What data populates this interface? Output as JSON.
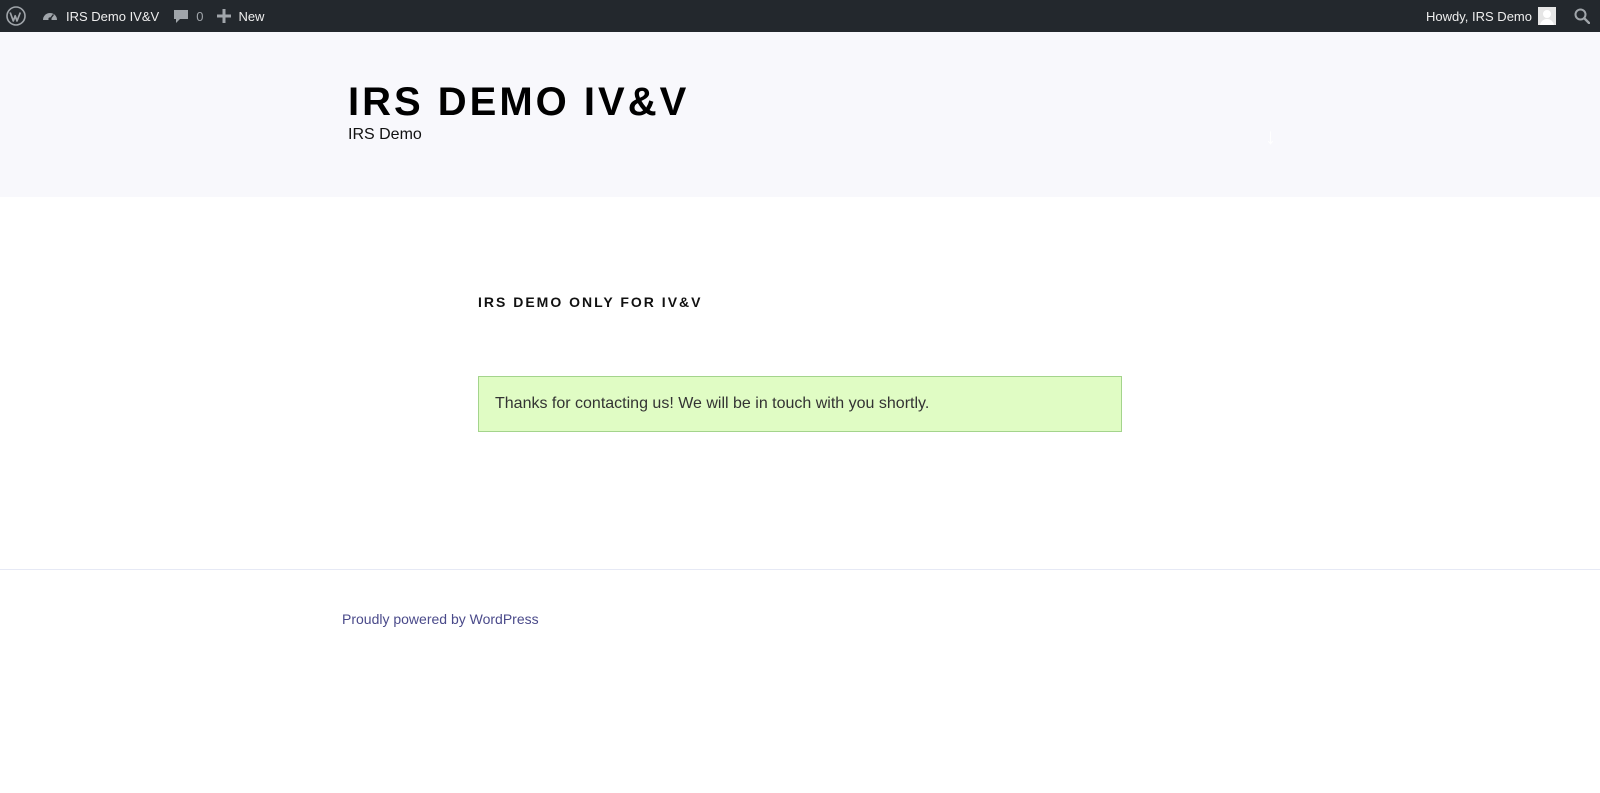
{
  "adminbar": {
    "site_name": "IRS Demo IV&V",
    "comments_count": "0",
    "new_label": "New",
    "greeting": "Howdy, IRS Demo",
    "icons": {
      "wp": "wordpress-logo-icon",
      "site": "dashboard-icon",
      "comments": "comment-bubble-icon",
      "new": "plus-icon",
      "search": "search-icon"
    }
  },
  "header": {
    "title": "IRS DEMO IV&V",
    "description": "IRS Demo",
    "scroll_arrow": "↓"
  },
  "main": {
    "entry_title": "IRS DEMO ONLY FOR IV&V",
    "notice": "Thanks for contacting us! We will be in touch with you shortly."
  },
  "footer": {
    "credit": "Proudly powered by WordPress"
  },
  "colors": {
    "adminbar_bg": "#23282d",
    "header_bg": "#f8f8fc",
    "notice_bg": "#e0fcc4",
    "notice_border": "#a4d48c",
    "link": "#4a4a8a"
  }
}
